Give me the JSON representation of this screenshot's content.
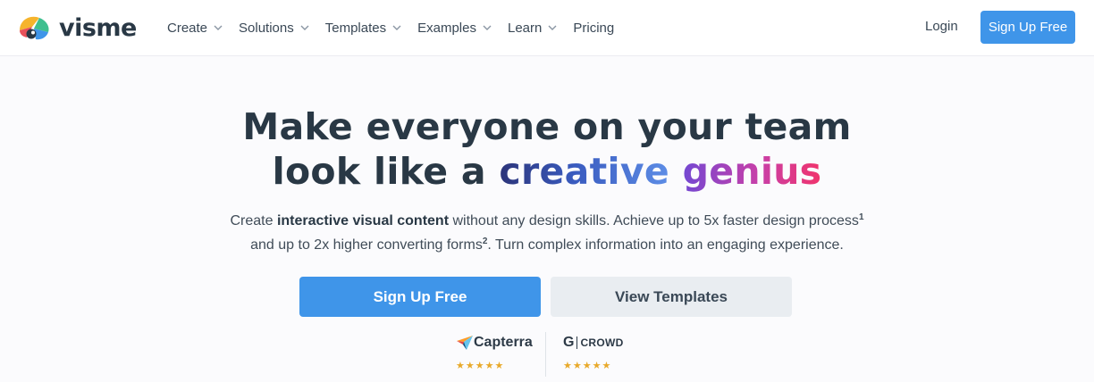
{
  "nav": {
    "logo_text": "visme",
    "items": [
      {
        "label": "Create",
        "has_dropdown": true
      },
      {
        "label": "Solutions",
        "has_dropdown": true
      },
      {
        "label": "Templates",
        "has_dropdown": true
      },
      {
        "label": "Examples",
        "has_dropdown": true
      },
      {
        "label": "Learn",
        "has_dropdown": true
      },
      {
        "label": "Pricing",
        "has_dropdown": false
      }
    ],
    "login_label": "Login",
    "signup_label": "Sign Up Free"
  },
  "hero": {
    "line1": "Make everyone on your team",
    "line2_prefix": "look like a ",
    "line2_word1": "creative",
    "line2_space": " ",
    "line2_word2": "genius",
    "sub1_pre": "Create ",
    "sub1_bold": "interactive visual content",
    "sub1_post": " without any design skills. Achieve up to 5x faster design process",
    "sub1_sup": "1",
    "sub2_pre": "and up to 2x higher converting forms",
    "sub2_sup": "2",
    "sub2_post": ". Turn complex information into an engaging experience.",
    "cta_primary": "Sign Up Free",
    "cta_secondary": "View Templates"
  },
  "ratings": {
    "capterra": {
      "name": "Capterra",
      "stars": "★★★★★"
    },
    "g2": {
      "name": "G",
      "crowd": "CROWD",
      "stars": "★★★★★"
    }
  },
  "colors": {
    "accent": "#3f95e9",
    "text": "#293845"
  }
}
